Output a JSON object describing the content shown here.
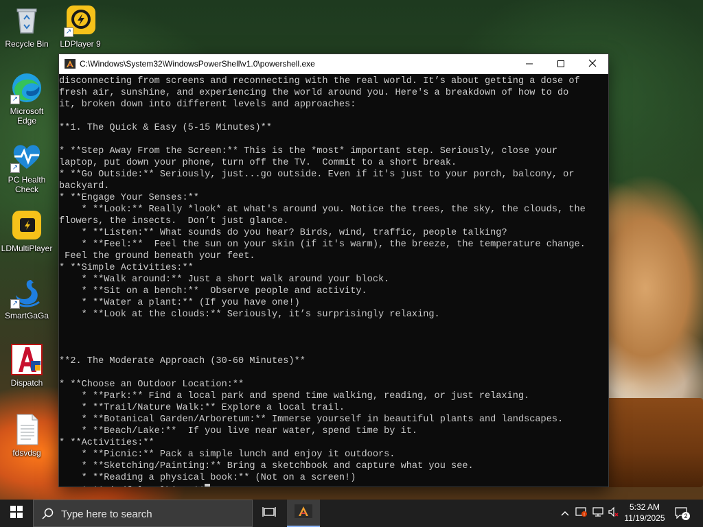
{
  "desktop": {
    "icons": [
      {
        "label": "Recycle Bin"
      },
      {
        "label": "LDPlayer 9"
      },
      {
        "label": "Microsoft Edge"
      },
      {
        "label": "PC Health Check"
      },
      {
        "label": "LDMultiPlayer"
      },
      {
        "label": "SmartGaGa"
      },
      {
        "label": "Dispatch"
      },
      {
        "label": "fdsvdsg"
      }
    ]
  },
  "console": {
    "title": "C:\\Windows\\System32\\WindowsPowerShell\\v1.0\\powershell.exe",
    "lines": [
      "disconnecting from screens and reconnecting with the real world. It’s about getting a dose of",
      "fresh air, sunshine, and experiencing the world around you. Here's a breakdown of how to do",
      "it, broken down into different levels and approaches:",
      "",
      "**1. The Quick & Easy (5-15 Minutes)**",
      "",
      "* **Step Away From the Screen:** This is the *most* important step. Seriously, close your",
      "laptop, put down your phone, turn off the TV.  Commit to a short break.",
      "* **Go Outside:** Seriously, just...go outside. Even if it's just to your porch, balcony, or",
      "backyard.",
      "* **Engage Your Senses:**",
      "    * **Look:** Really *look* at what's around you. Notice the trees, the sky, the clouds, the",
      "flowers, the insects.  Don’t just glance.",
      "    * **Listen:** What sounds do you hear? Birds, wind, traffic, people talking?",
      "    * **Feel:**  Feel the sun on your skin (if it's warm), the breeze, the temperature change.",
      " Feel the ground beneath your feet.",
      "* **Simple Activities:**",
      "    * **Walk around:** Just a short walk around your block.",
      "    * **Sit on a bench:**  Observe people and activity.",
      "    * **Water a plant:** (If you have one!)",
      "    * **Look at the clouds:** Seriously, it’s surprisingly relaxing.",
      "",
      "",
      "",
      "**2. The Moderate Approach (30-60 Minutes)**",
      "",
      "* **Choose an Outdoor Location:**",
      "    * **Park:** Find a local park and spend time walking, reading, or just relaxing.",
      "    * **Trail/Nature Walk:** Explore a local trail.",
      "    * **Botanical Garden/Arboretum:** Immerse yourself in beautiful plants and landscapes.",
      "    * **Beach/Lake:**  If you live near water, spend time by it.",
      "* **Activities:**",
      "    * **Picnic:** Pack a simple lunch and enjoy it outdoors.",
      "    * **Sketching/Painting:** Bring a sketchbook and capture what you see.",
      "    * **Reading a physical book:** (Not on a screen!)",
      "    * **Mindful Walking:**"
    ]
  },
  "taskbar": {
    "search_placeholder": "Type here to search",
    "time": "5:32 AM",
    "date": "11/19/2025",
    "notification_count": "2"
  },
  "colors": {
    "console_bg": "#0c0c0c",
    "console_text": "#cccccc",
    "taskbar_bg": "#1f1f1f",
    "titlebar_bg": "#ffffff"
  }
}
